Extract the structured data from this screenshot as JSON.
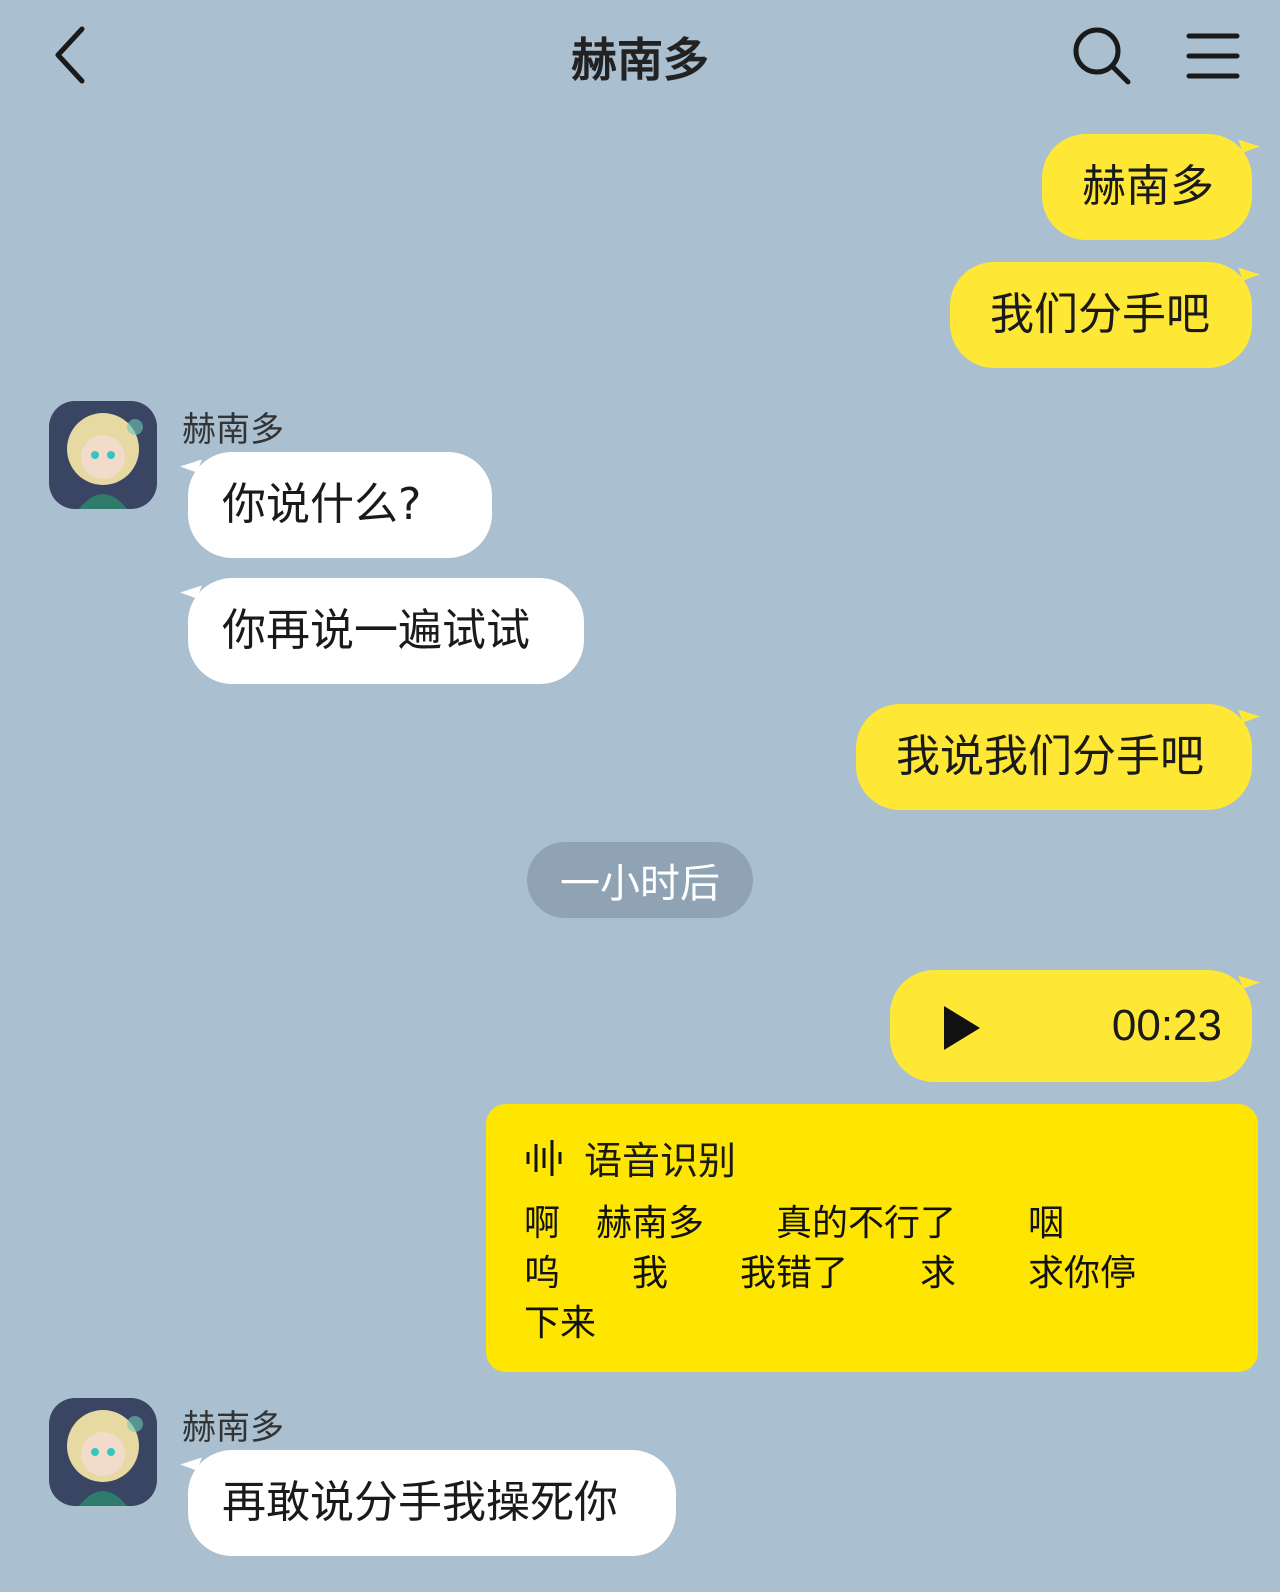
{
  "header": {
    "title": "赫南多",
    "back_icon": "chevron-left-icon",
    "search_icon": "search-icon",
    "menu_icon": "menu-icon"
  },
  "messages": {
    "m1": {
      "from": "me",
      "text": "赫南多"
    },
    "m2": {
      "from": "me",
      "text": "我们分手吧"
    },
    "g1_sender": "赫南多",
    "m3": {
      "from": "them",
      "text": "你说什么?"
    },
    "m4": {
      "from": "them",
      "text": "你再说一遍试试"
    },
    "m5": {
      "from": "me",
      "text": "我说我们分手吧"
    },
    "time_divider": "一小时后",
    "voice": {
      "duration": "00:23",
      "icon": "play-icon"
    },
    "transcript": {
      "title": "语音识别",
      "icon": "sound-wave-icon",
      "text": "啊　赫南多　　真的不行了　　咽\n呜　　我　　我错了　　求　　求你停\n下来"
    },
    "g2_sender": "赫南多",
    "m6": {
      "from": "them",
      "text": "再敢说分手我操死你"
    }
  },
  "colors": {
    "background": "#aac0d1",
    "my_bubble": "#ffe735",
    "their_bubble": "#ffffff",
    "transcript": "#ffe600",
    "time_pill": "#8fa3b4"
  }
}
